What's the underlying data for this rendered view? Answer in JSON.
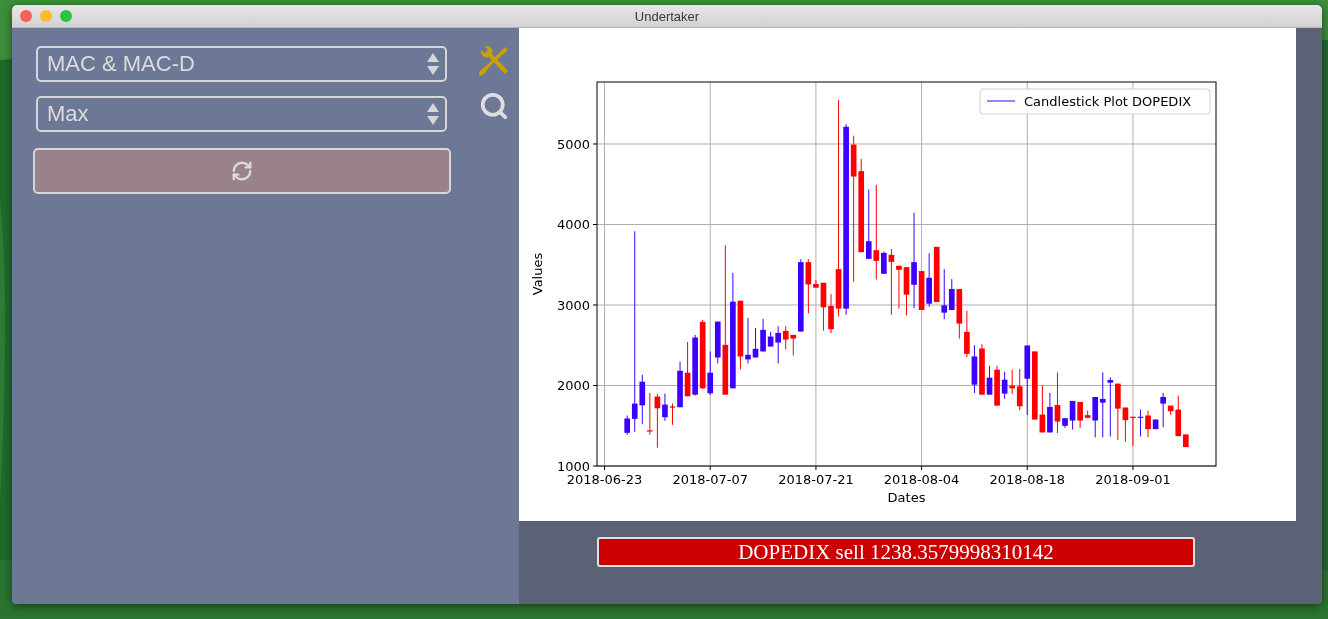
{
  "window": {
    "title": "Undertaker"
  },
  "selects": [
    {
      "value": "MAC & MAC-D"
    },
    {
      "value": "Max"
    }
  ],
  "chart": {
    "chart_data": {
      "type": "candlestick",
      "xlabel": "Dates",
      "ylabel": "Values",
      "xlim": [
        "2018-06-22",
        "2018-09-12"
      ],
      "ylim": [
        1000,
        5770
      ],
      "grid": true,
      "xticks": [
        "2018-06-23",
        "2018-07-07",
        "2018-07-21",
        "2018-08-04",
        "2018-08-18",
        "2018-09-01"
      ],
      "yticks": [
        1000,
        2000,
        3000,
        4000,
        5000
      ],
      "x": [
        "2018-06-26",
        "2018-06-27",
        "2018-06-28",
        "2018-06-29",
        "2018-06-30",
        "2018-07-01",
        "2018-07-02",
        "2018-07-03",
        "2018-07-04",
        "2018-07-05",
        "2018-07-06",
        "2018-07-07",
        "2018-07-08",
        "2018-07-09",
        "2018-07-10",
        "2018-07-11",
        "2018-07-12",
        "2018-07-13",
        "2018-07-14",
        "2018-07-15",
        "2018-07-16",
        "2018-07-17",
        "2018-07-18",
        "2018-07-19",
        "2018-07-20",
        "2018-07-21",
        "2018-07-22",
        "2018-07-23",
        "2018-07-24",
        "2018-07-25",
        "2018-07-26",
        "2018-07-27",
        "2018-07-28",
        "2018-07-29",
        "2018-07-30",
        "2018-07-31",
        "2018-08-01",
        "2018-08-02",
        "2018-08-03",
        "2018-08-04",
        "2018-08-05",
        "2018-08-06",
        "2018-08-07",
        "2018-08-08",
        "2018-08-09",
        "2018-08-10",
        "2018-08-11",
        "2018-08-12",
        "2018-08-13",
        "2018-08-14",
        "2018-08-15",
        "2018-08-16",
        "2018-08-17",
        "2018-08-18",
        "2018-08-19",
        "2018-08-20",
        "2018-08-21",
        "2018-08-22",
        "2018-08-23",
        "2018-08-24",
        "2018-08-25",
        "2018-08-26",
        "2018-08-27",
        "2018-08-28",
        "2018-08-29",
        "2018-08-30",
        "2018-08-31",
        "2018-09-01",
        "2018-09-02",
        "2018-09-03",
        "2018-09-04",
        "2018-09-05",
        "2018-09-06",
        "2018-09-07",
        "2018-09-08"
      ],
      "series": [
        {
          "name": "Candlestick Plot DOPEDIX",
          "color": "#3c00ff",
          "ohlc": [
            [
              1412,
              1627,
              1388,
              1590
            ],
            [
              1585,
              3915,
              1425,
              1775
            ],
            [
              1754,
              2134,
              1523,
              2047
            ],
            null,
            null,
            [
              1606,
              1899,
              1561,
              1763
            ],
            null,
            [
              1730,
              2295,
              1730,
              2183
            ],
            null,
            [
              1886,
              2629,
              1874,
              2596
            ],
            null,
            [
              1903,
              2423,
              1882,
              2159
            ],
            [
              2348,
              2794,
              2274,
              2794
            ],
            null,
            [
              1965,
              3400,
              1965,
              3041
            ],
            null,
            [
              2324,
              2839,
              2274,
              2381
            ],
            [
              2348,
              2715,
              2348,
              2456
            ],
            [
              2423,
              2827,
              2423,
              2691
            ],
            [
              2484,
              2666,
              2484,
              2608
            ],
            [
              2534,
              2736,
              2274,
              2653
            ],
            null,
            null,
            [
              2670,
              3569,
              2670,
              3532
            ],
            null,
            null,
            null,
            null,
            null,
            [
              2955,
              5247,
              2880,
              5214
            ],
            null,
            null,
            [
              3573,
              4435,
              3573,
              3792
            ],
            null,
            [
              3388,
              3664,
              3388,
              3647
            ],
            null,
            null,
            null,
            [
              3251,
              4146,
              2959,
              3532
            ],
            null,
            [
              3016,
              3643,
              2979,
              3338
            ],
            null,
            [
              2905,
              3445,
              2823,
              2996
            ],
            [
              2938,
              3322,
              2938,
              3198
            ],
            null,
            null,
            [
              2010,
              2501,
              1907,
              2361
            ],
            null,
            [
              1886,
              2245,
              1886,
              2097
            ],
            null,
            [
              1899,
              2171,
              1833,
              2072
            ],
            null,
            null,
            [
              2084,
              2497,
              1634,
              2497
            ],
            null,
            null,
            [
              1417,
              1907,
              1417,
              1734
            ],
            null,
            [
              1499,
              1594,
              1474,
              1594
            ],
            [
              1565,
              1808,
              1454,
              1808
            ],
            null,
            null,
            [
              1565,
              1857,
              1355,
              1857
            ],
            [
              1787,
              2163,
              1355,
              1833
            ],
            [
              2035,
              2101,
              1367,
              2068
            ],
            null,
            null,
            null,
            [
              1608,
              1701,
              1367,
              1612
            ],
            null,
            [
              1458,
              1577,
              1458,
              1577
            ],
            [
              1775,
              1907,
              1482,
              1857
            ],
            null,
            null,
            null
          ]
        },
        {
          "color": "#ff0000",
          "ohlc": [
            null,
            null,
            null,
            [
              1443,
              1907,
              1388,
              1438
            ],
            [
              1862,
              1895,
              1227,
              1717
            ],
            null,
            [
              1740,
              1775,
              1511,
              1735
            ],
            null,
            [
              2159,
              2542,
              1866,
              1866
            ],
            null,
            [
              2790,
              2814,
              1957,
              1965
            ],
            null,
            null,
            [
              2505,
              3742,
              1886,
              1886
            ],
            null,
            [
              3053,
              3053,
              2200,
              2361
            ],
            null,
            null,
            null,
            null,
            null,
            [
              2678,
              2736,
              2451,
              2571
            ],
            [
              2629,
              2629,
              2373,
              2583
            ],
            null,
            [
              3532,
              3569,
              2897,
              3256
            ],
            [
              3260,
              3309,
              3215,
              3215
            ],
            [
              3276,
              3276,
              2682,
              2971
            ],
            [
              2988,
              3136,
              2650,
              2699
            ],
            [
              3445,
              5548,
              2856,
              2955
            ],
            null,
            [
              4992,
              5103,
              3289,
              4596
            ],
            [
              4662,
              4814,
              3656,
              3656
            ],
            null,
            [
              3680,
              4493,
              3317,
              3548
            ],
            null,
            [
              3623,
              3693,
              2880,
              3536
            ],
            [
              3487,
              3487,
              2955,
              3437
            ],
            [
              3470,
              3470,
              2872,
              3128
            ],
            null,
            [
              3421,
              3421,
              2938,
              2938
            ],
            null,
            [
              3722,
              3722,
              3037,
              3037
            ],
            null,
            null,
            [
              3198,
              3198,
              2583,
              2769
            ],
            [
              2666,
              2930,
              2353,
              2394
            ],
            null,
            [
              2460,
              2513,
              1886,
              1886
            ],
            null,
            [
              2196,
              2245,
              1750,
              1750
            ],
            null,
            [
              1998,
              2196,
              1895,
              1965
            ],
            [
              1990,
              2204,
              1693,
              1742
            ],
            null,
            [
              2423,
              2423,
              1577,
              1577
            ],
            [
              1639,
              2002,
              1417,
              1417
            ],
            null,
            [
              1758,
              2163,
              1409,
              1552
            ],
            null,
            null,
            [
              1796,
              1796,
              1474,
              1565
            ],
            [
              1631,
              1689,
              1598,
              1598
            ],
            null,
            null,
            null,
            [
              2023,
              2023,
              1322,
              1713
            ],
            [
              1726,
              1726,
              1302,
              1569
            ],
            [
              1612,
              1612,
              1248,
              1608
            ],
            null,
            [
              1627,
              1689,
              1359,
              1458
            ],
            null,
            null,
            [
              1750,
              1750,
              1635,
              1680
            ],
            [
              1701,
              1874,
              1371,
              1371
            ],
            [
              1392,
              1392,
              1235,
              1235
            ]
          ]
        }
      ]
    }
  },
  "signal": {
    "text": "DOPEDIX sell 1238.3579998310142"
  }
}
